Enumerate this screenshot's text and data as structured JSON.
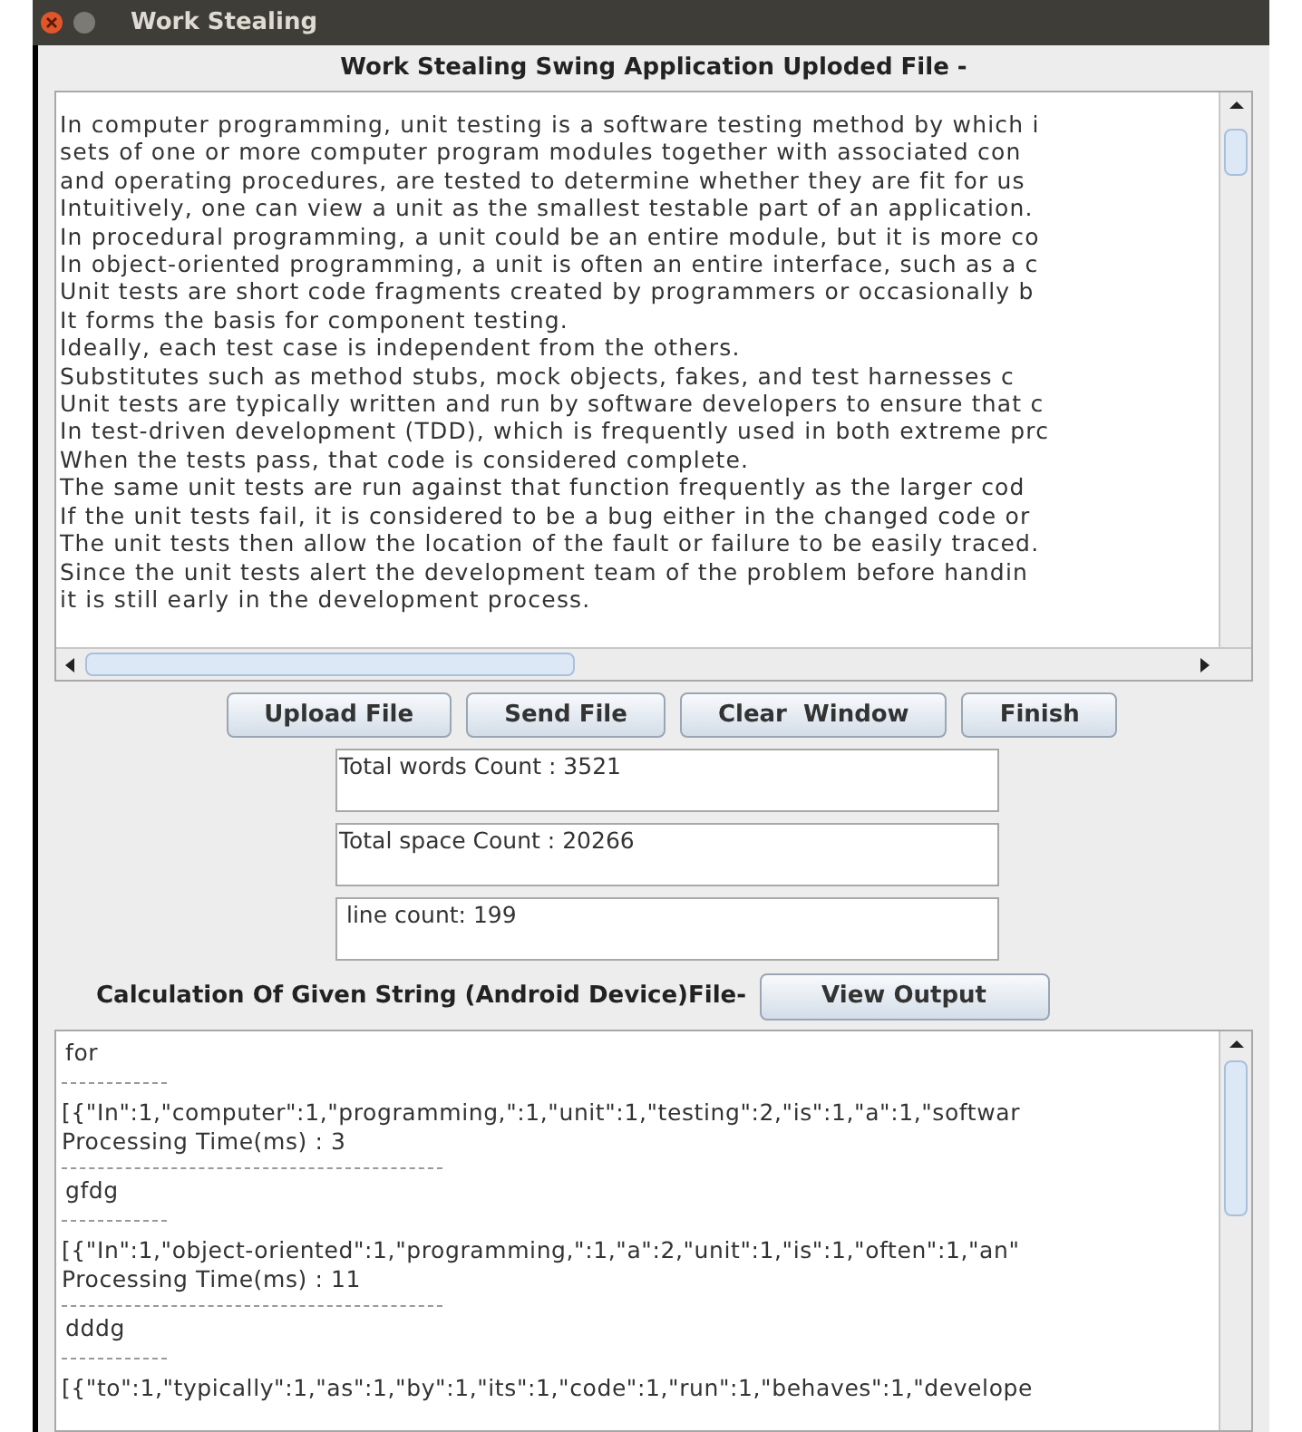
{
  "window": {
    "title": "Work Stealing"
  },
  "upload_panel": {
    "heading": "Work Stealing Swing Application Uploded File -"
  },
  "file_text": {
    "lines": [
      "In computer programming, unit testing is a software testing method by which i",
      "sets of one or more computer program modules together with associated con",
      "and operating procedures, are tested to determine whether they are fit for us",
      "Intuitively, one can view a unit as the smallest testable part of an application.",
      "In procedural programming, a unit could be an entire module, but it is more co",
      "In object-oriented programming, a unit is often an entire interface, such as a c",
      "Unit tests are short code fragments created by programmers or occasionally b",
      "It forms the basis for component testing.",
      "Ideally, each test case is independent from the others.",
      "Substitutes such as method stubs, mock objects, fakes, and test harnesses c",
      "Unit tests are typically written and run by software developers to ensure that c",
      "In test-driven development (TDD), which is frequently used in both extreme prc",
      "When the tests pass, that code is considered complete.",
      "The same unit tests are run against that function frequently as the larger cod",
      "If the unit tests fail, it is considered to be a bug either in the changed code or",
      "The unit tests then allow the location of the fault or failure to be easily traced.",
      "Since the unit tests alert the development team of the problem before handin",
      "it is still early in the development process."
    ]
  },
  "buttons": [
    "Upload File",
    "Send File",
    "Clear  Window",
    "Finish"
  ],
  "counts": [
    "Total words Count : 3521",
    "Total space Count : 20266",
    " line count: 199"
  ],
  "output_panel": {
    "heading": "Calculation Of Given String (Android Device)File-",
    "button": "View Output"
  },
  "output": {
    "entries": [
      {
        "input": "for",
        "result": "[{\"In\":1,\"computer\":1,\"programming,\":1,\"unit\":1,\"testing\":2,\"is\":1,\"a\":1,\"softwar",
        "time": "Processing Time(ms) : 3"
      },
      {
        "input": "gfdg",
        "result": "[{\"In\":1,\"object-oriented\":1,\"programming,\":1,\"a\":2,\"unit\":1,\"is\":1,\"often\":1,\"an\"",
        "time": "Processing Time(ms) : 11"
      },
      {
        "input": "dddg",
        "result": "[{\"to\":1,\"typically\":1,\"as\":1,\"by\":1,\"its\":1,\"code\":1,\"run\":1,\"behaves\":1,\"develope"
      }
    ]
  }
}
